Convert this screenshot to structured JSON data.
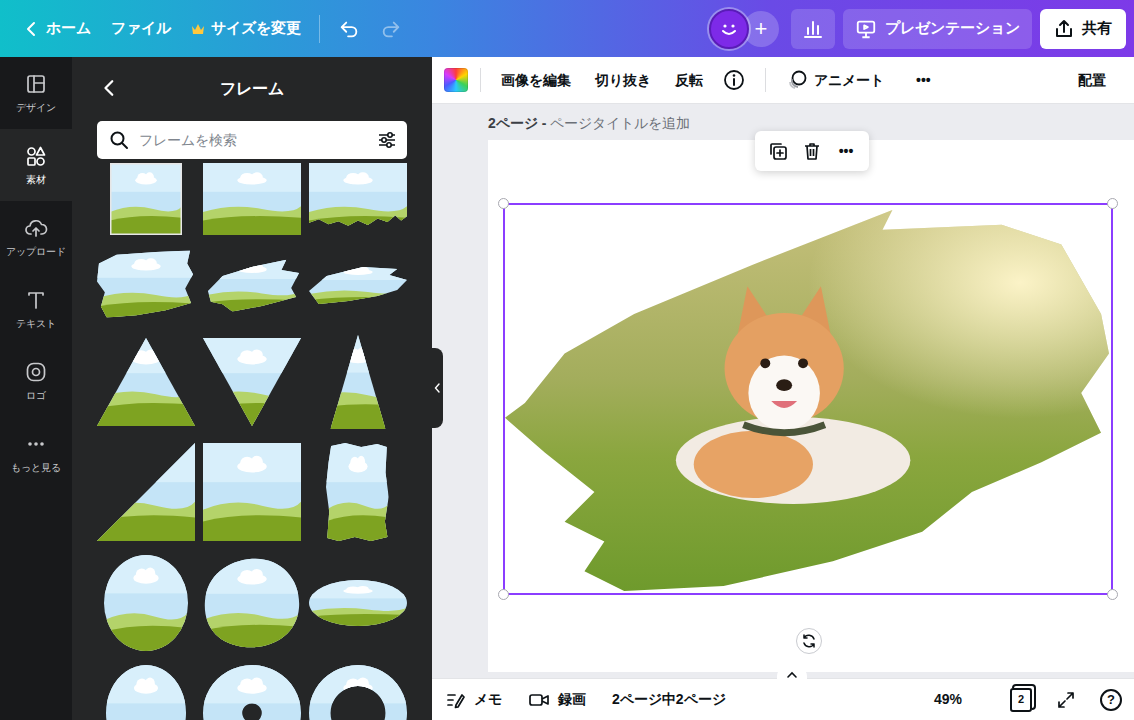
{
  "topbar": {
    "back": "ホーム",
    "file": "ファイル",
    "resize": "サイズを変更",
    "add": "+",
    "present": "プレゼンテーション",
    "share": "共有"
  },
  "history": {
    "undo_disabled": false,
    "redo_disabled": true
  },
  "rail": [
    {
      "label": "デザイン",
      "selected": false
    },
    {
      "label": "素材",
      "selected": true
    },
    {
      "label": "アップロード",
      "selected": false
    },
    {
      "label": "テキスト",
      "selected": false
    },
    {
      "label": "ロゴ",
      "selected": false
    },
    {
      "label": "もっと見る",
      "selected": false
    }
  ],
  "panel": {
    "title": "フレーム",
    "search": {
      "placeholder": "フレームを検索"
    },
    "frames": [
      {
        "kind": "framed-rect"
      },
      {
        "kind": "rect"
      },
      {
        "kind": "torn-bottom"
      },
      {
        "kind": "brush-wide"
      },
      {
        "kind": "brush-small"
      },
      {
        "kind": "brush-thin"
      },
      {
        "kind": "triangle"
      },
      {
        "kind": "triangle-down"
      },
      {
        "kind": "triangle-narrow"
      },
      {
        "kind": "right-triangle"
      },
      {
        "kind": "square"
      },
      {
        "kind": "torn-tall"
      },
      {
        "kind": "oval"
      },
      {
        "kind": "blob"
      },
      {
        "kind": "ellipse-flat"
      },
      {
        "kind": "circle"
      },
      {
        "kind": "ring"
      },
      {
        "kind": "ring-thick"
      }
    ]
  },
  "toolbar": {
    "edit_image": "画像を編集",
    "crop": "切り抜き",
    "flip": "反転",
    "animate": "アニメート",
    "more": "•••",
    "arrange": "配置"
  },
  "page": {
    "label": "2ページ -",
    "title_placeholder": "ページタイトルを追加"
  },
  "context_menu": {
    "more": "•••"
  },
  "selection": {
    "selected": true
  },
  "bottombar": {
    "notes": "メモ",
    "record": "録画",
    "pages": "2ページ中2ページ",
    "zoom": "49%",
    "page_count": "2",
    "help": "?"
  }
}
